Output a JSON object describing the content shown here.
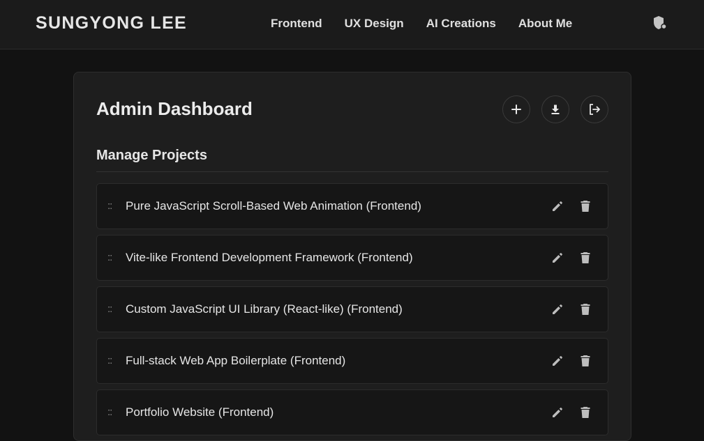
{
  "header": {
    "brand": "SUNGYONG LEE",
    "nav": [
      "Frontend",
      "UX Design",
      "AI Creations",
      "About Me"
    ],
    "admin_icon": "shield-lock-icon"
  },
  "dashboard": {
    "title": "Admin Dashboard",
    "actions": [
      {
        "name": "add-project-button",
        "icon": "plus-icon"
      },
      {
        "name": "download-button",
        "icon": "download-icon"
      },
      {
        "name": "logout-button",
        "icon": "logout-icon"
      }
    ],
    "section_title": "Manage Projects",
    "projects": [
      {
        "title": "Pure JavaScript Scroll-Based Web Animation (Frontend)"
      },
      {
        "title": "Vite-like Frontend Development Framework (Frontend)"
      },
      {
        "title": "Custom JavaScript UI Library (React-like) (Frontend)"
      },
      {
        "title": "Full-stack Web App Boilerplate (Frontend)"
      },
      {
        "title": "Portfolio Website (Frontend)"
      }
    ],
    "drag_handle": "::",
    "row_icons": {
      "edit": "pencil-icon",
      "delete": "trash-icon"
    }
  },
  "colors": {
    "page_bg": "#121212",
    "header_bg": "#1b1b1b",
    "card_bg": "#1e1e1e",
    "row_bg": "#161616",
    "icon": "#bdbdbd"
  }
}
